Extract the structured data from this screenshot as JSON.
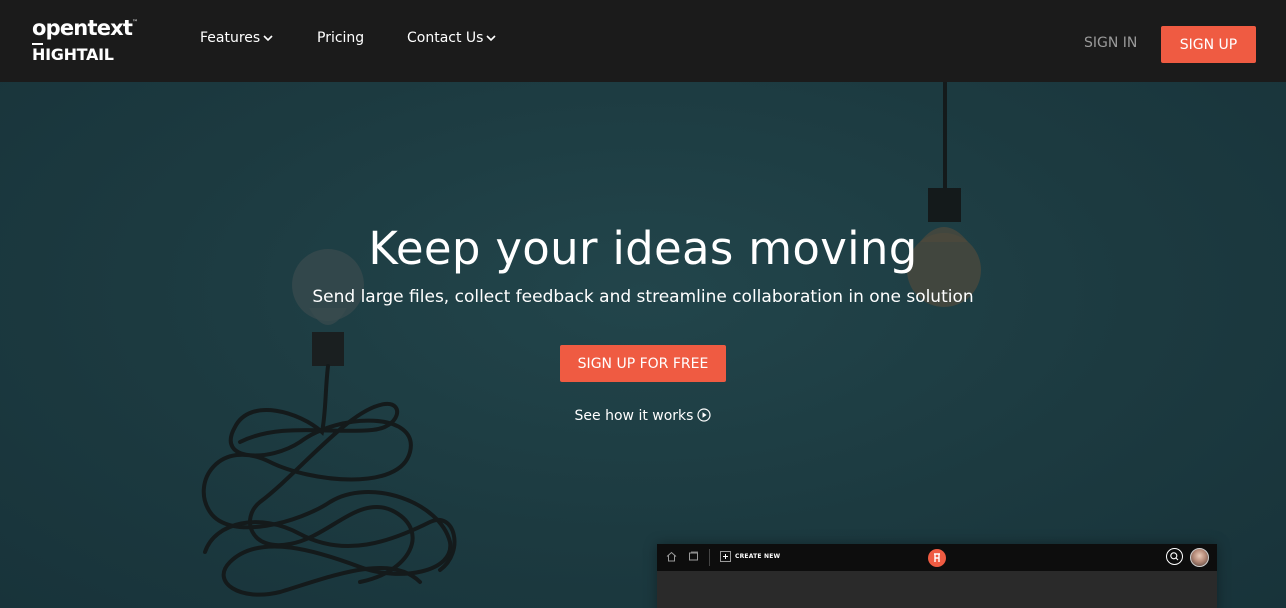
{
  "brand": {
    "opentext": "opentext",
    "trademark": "™",
    "hightail": "HIGHTAIL"
  },
  "nav": {
    "items": [
      {
        "label": "Features",
        "has_dropdown": true
      },
      {
        "label": "Pricing",
        "has_dropdown": false
      },
      {
        "label": "Contact Us",
        "has_dropdown": true
      }
    ],
    "sign_in": "SIGN IN",
    "sign_up": "SIGN UP"
  },
  "hero": {
    "title": "Keep your ideas moving",
    "subtitle": "Send large files, collect feedback and streamline collaboration in one solution",
    "cta": "SIGN UP FOR FREE",
    "see_how": "See how it works",
    "decor_icons": [
      "light-bulb-dim-icon",
      "light-bulb-lit-icon"
    ]
  },
  "app_preview": {
    "create_new": "CREATE NEW",
    "icons": [
      "home-icon",
      "folder-icon",
      "plus-icon",
      "hightail-logo-icon",
      "search-icon",
      "avatar"
    ]
  },
  "colors": {
    "nav_bg": "#1b1b1b",
    "hero_bg": "#1f3a3f",
    "accent": "#ef5b42",
    "text": "#ffffff",
    "muted": "#9a9a9a"
  }
}
